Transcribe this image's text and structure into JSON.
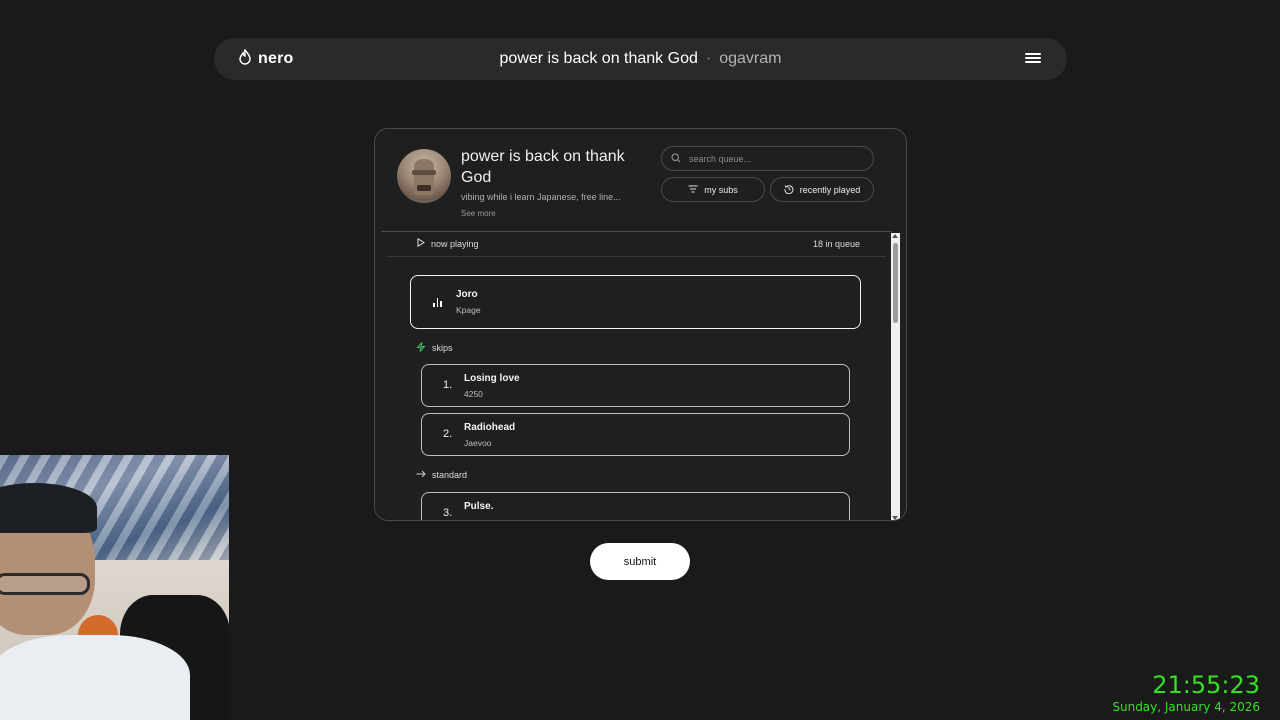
{
  "navbar": {
    "brand": "nero",
    "room_title": "power is back on thank God",
    "separator": "·",
    "username": "ogavram"
  },
  "room": {
    "title": "power is back on thank God",
    "description": "vibing while i learn Japanese, free line...",
    "see_more": "See more"
  },
  "search": {
    "placeholder": "search queue..."
  },
  "filters": {
    "my_subs": "my subs",
    "recently_played": "recently played"
  },
  "queue_header": {
    "now_playing": "now playing",
    "count": "18 in queue"
  },
  "now_playing": {
    "title": "Joro",
    "artist": "Kpage"
  },
  "sections": {
    "skips": "skips",
    "standard": "standard"
  },
  "skips": [
    {
      "num": "1.",
      "title": "Losing love",
      "artist": "4250"
    },
    {
      "num": "2.",
      "title": "Radiohead",
      "artist": "Jaevoo"
    }
  ],
  "standard": [
    {
      "num": "3.",
      "title": "Pulse.",
      "artist": ""
    }
  ],
  "submit_label": "submit",
  "clock": {
    "time": "21:55:23",
    "date": "Sunday, January 4, 2026"
  },
  "colors": {
    "accent_green": "#34e024",
    "skip_icon": "#3fbf5f",
    "bg": "#1a1a1a"
  }
}
